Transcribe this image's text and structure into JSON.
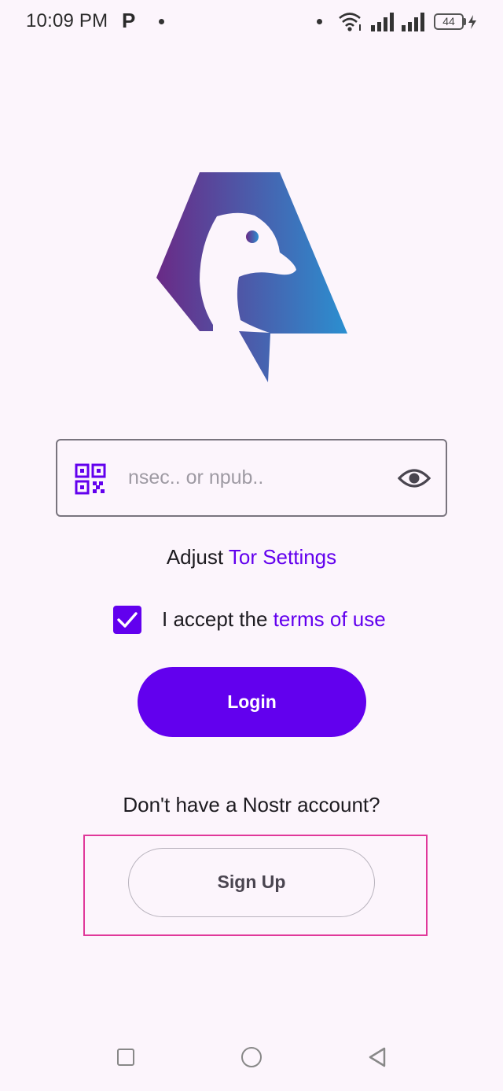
{
  "status_bar": {
    "time": "10:09 PM",
    "notification_letter": "P",
    "battery": "44"
  },
  "login": {
    "key_placeholder": "nsec.. or npub..",
    "key_value": "",
    "tor_prefix": "Adjust",
    "tor_link": "Tor Settings",
    "accept_prefix": "I accept the",
    "terms_link": "terms of use",
    "terms_checked": true,
    "login_label": "Login",
    "no_account_text": "Don't have a Nostr account?",
    "signup_label": "Sign Up"
  },
  "icons": {
    "qr": "qr-code-icon",
    "eye": "eye-icon",
    "checkbox": "checkmark-icon",
    "nav_recents": "square-icon",
    "nav_home": "circle-icon",
    "nav_back": "triangle-back-icon"
  },
  "colors": {
    "accent": "#6200ee",
    "background": "#fcf5fc",
    "highlight": "#e0389a",
    "logo_gradient_start": "#6a2a86",
    "logo_gradient_end": "#2b8fd0"
  }
}
